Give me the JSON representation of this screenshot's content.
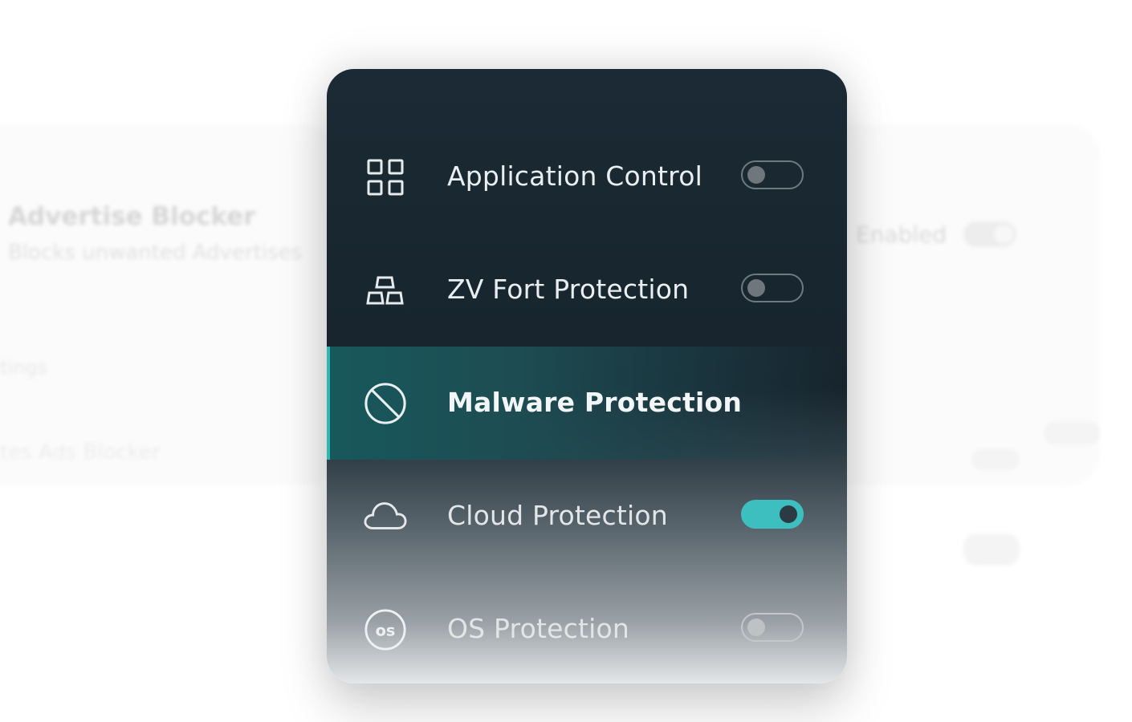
{
  "background": {
    "card_title": "Advertise Blocker",
    "card_subtitle": "Blocks unwanted Advertises",
    "settings_label": "tings",
    "row_label": "tes Ads Blocker",
    "enabled_label": "Enabled"
  },
  "menu": {
    "items": [
      {
        "label": "Application Control",
        "icon": "grid-icon",
        "toggle_on": false
      },
      {
        "label": "ZV Fort Protection",
        "icon": "blocks-icon",
        "toggle_on": false
      },
      {
        "label": "Malware Protection",
        "icon": "prohibited-icon",
        "active": true
      },
      {
        "label": "Cloud Protection",
        "icon": "cloud-icon",
        "toggle_on": true
      },
      {
        "label": "OS Protection",
        "icon": "os-icon",
        "toggle_on": false
      }
    ]
  },
  "colors": {
    "panel_dark": "#1b2a34",
    "accent_teal": "#3dbfc0",
    "active_bar": "#2fb7b4"
  }
}
